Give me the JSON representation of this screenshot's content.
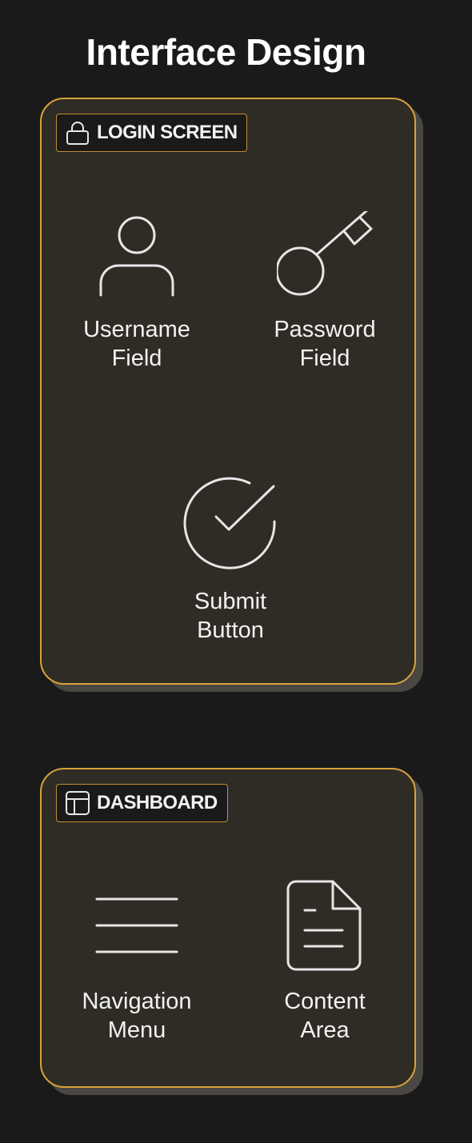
{
  "page": {
    "title": "Interface Design"
  },
  "colors": {
    "background": "#1a1a1a",
    "panel": "#2f2c26",
    "border_accent": "#d9a23a",
    "label_border": "#c48f30",
    "text": "#ececec"
  },
  "groups": [
    {
      "label": "LOGIN SCREEN",
      "icon": "lock-icon",
      "nodes": [
        {
          "label": "Username\nField",
          "icon": "user-icon"
        },
        {
          "label": "Password\nField",
          "icon": "key-icon"
        },
        {
          "label": "Submit\nButton",
          "icon": "check-circle-icon"
        }
      ]
    },
    {
      "label": "DASHBOARD",
      "icon": "layout-icon",
      "nodes": [
        {
          "label": "Navigation\nMenu",
          "icon": "menu-icon"
        },
        {
          "label": "Content\nArea",
          "icon": "file-text-icon"
        }
      ]
    }
  ]
}
